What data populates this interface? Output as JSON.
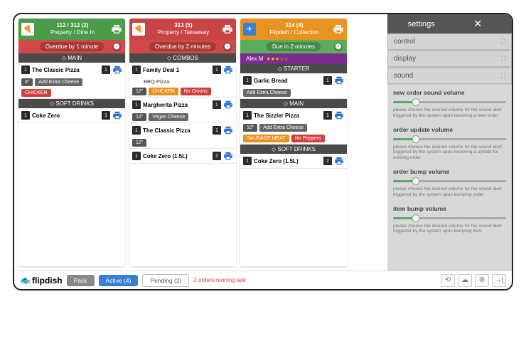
{
  "cards": [
    {
      "hdClass": "hd-green",
      "logo": "🍕",
      "title_l1": "112 / 312 (2)",
      "title_l2": "Property / Dine In",
      "overdue": {
        "cls": "ob-red",
        "text": "Overdue by 1 minute"
      },
      "sections": [
        {
          "title": "MAIN",
          "items": [
            {
              "qty": "1",
              "name": "The Classic Pizza",
              "print": true,
              "tags": [
                {
                  "cls": "tag-sz",
                  "t": "8\""
                },
                {
                  "cls": "tag-gr",
                  "t": "Add Extra Cheese"
                }
              ],
              "tags2": [
                {
                  "cls": "tag-rd",
                  "t": "CHICKEN"
                }
              ]
            }
          ]
        },
        {
          "title": "SOFT DRINKS",
          "items": [
            {
              "qty": "1",
              "name": "Coke Zero",
              "print": true
            }
          ]
        }
      ]
    },
    {
      "hdClass": "hd-red",
      "logo": "🍕",
      "title_l1": "313 (5)",
      "title_l2": "Property / Takeaway",
      "overdue": {
        "cls": "ob-red",
        "text": "Overdue by 2 minutes"
      },
      "sections": [
        {
          "title": "COMBOS",
          "items": [
            {
              "qty": "1",
              "name": "Family Deal 1",
              "print": true,
              "sub": "BBQ Pizza",
              "tags": [
                {
                  "cls": "tag-sz",
                  "t": "12\""
                },
                {
                  "cls": "tag-or",
                  "t": "CHICKEN"
                },
                {
                  "cls": "tag-rd",
                  "t": "No Onions"
                }
              ]
            },
            {
              "qty": "1",
              "name": "Margherita Pizza",
              "print": true,
              "tags": [
                {
                  "cls": "tag-sz",
                  "t": "12\""
                },
                {
                  "cls": "tag-gr",
                  "t": "Vegan Cheese"
                }
              ]
            },
            {
              "qty": "1",
              "name": "The Classic Pizza",
              "print": true,
              "tags": [
                {
                  "cls": "tag-sz",
                  "t": "12\""
                }
              ]
            },
            {
              "qty": "1",
              "name": "Coke Zero (1.5L)",
              "qty2": "2",
              "print": true
            }
          ]
        }
      ]
    },
    {
      "hdClass": "hd-orange",
      "logo": "✈",
      "logofd": true,
      "title_l1": "314 (4)",
      "title_l2": "Flipdish / Collection",
      "overdue": {
        "cls": "ob-green",
        "text": "Due in 2 minutes"
      },
      "subbar": {
        "cls": "ob-purple",
        "name": "Alex M",
        "stars": "★★★☆☆"
      },
      "sections": [
        {
          "title": "STARTER",
          "items": [
            {
              "qty": "1",
              "name": "Garlic Bread",
              "print": true,
              "tags": [
                {
                  "cls": "tag-gr",
                  "t": "Add Extra Cheese"
                }
              ]
            }
          ]
        },
        {
          "title": "MAIN",
          "items": [
            {
              "qty": "1",
              "name": "The Sizzler Pizza",
              "print": true,
              "tags": [
                {
                  "cls": "tag-sz",
                  "t": "10\""
                },
                {
                  "cls": "tag-gr",
                  "t": "Add Extra Cheese"
                }
              ],
              "tags2": [
                {
                  "cls": "tag-or",
                  "t": "SAUSAGE MEAT"
                },
                {
                  "cls": "tag-rd",
                  "t": "No Peppers"
                }
              ]
            }
          ]
        },
        {
          "title": "SOFT DRINKS",
          "items": [
            {
              "qty": "1",
              "name": "Coke Zero (1.5L)",
              "qty2": "2",
              "print": true
            }
          ]
        }
      ]
    }
  ],
  "settings": {
    "title": "settings",
    "sections": [
      "control",
      "display",
      "sound"
    ],
    "sliders": [
      {
        "label": "new order sound volume",
        "help": "please choose the desired volume for the sound alert triggered by the system upon receiving a new order"
      },
      {
        "label": "order update volume",
        "help": "please choose the desired volume for the sound alert triggered by the system upon receiving a update for existing order"
      },
      {
        "label": "order bump volume",
        "help": "please choose the desired volume for the sound alert triggered by the system upon bumping order"
      },
      {
        "label": "item bump volume",
        "help": "please choose the desired volume for the sound alert triggered by the system upon bumping item"
      }
    ]
  },
  "footer": {
    "brand": "flipdish",
    "pack": "Pack",
    "active": "Active (4)",
    "pending": "Pending (2)",
    "late": "2 orders running late"
  }
}
